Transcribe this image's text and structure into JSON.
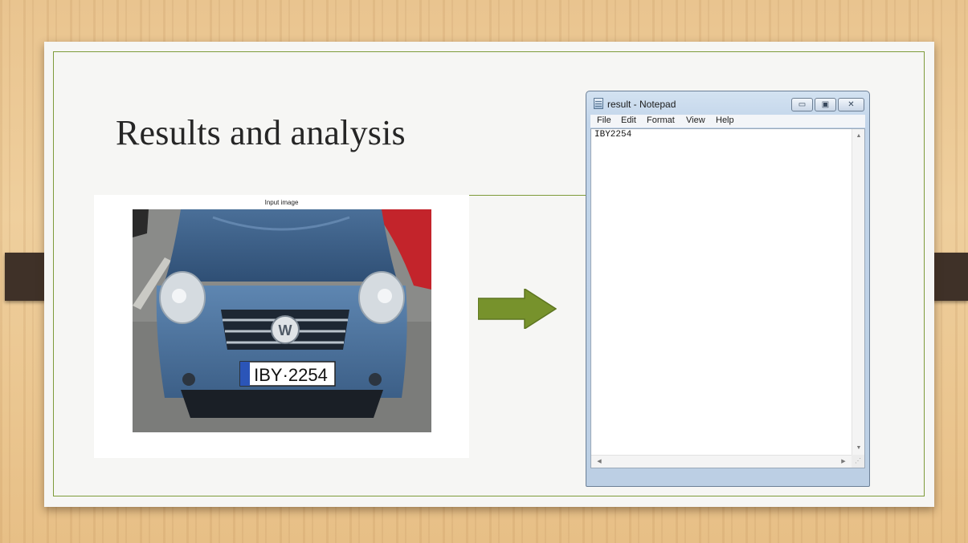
{
  "slide": {
    "title": "Results and analysis",
    "accent_color": "#7e9b3a",
    "tab_color": "#3f3128",
    "arrow_color": "#77922c"
  },
  "figure": {
    "caption": "Input image",
    "plate_text": "IBY·2254",
    "car_color": "#5b82aa"
  },
  "notepad": {
    "title": "result - Notepad",
    "icon": "notepad-icon",
    "window_buttons": {
      "minimize": "▭",
      "maximize": "▣",
      "close": "✕"
    },
    "menu": [
      "File",
      "Edit",
      "Format",
      "View",
      "Help"
    ],
    "content": "IBY2254",
    "scroll_icons": {
      "up": "▲",
      "down": "▼",
      "left": "◀",
      "right": "▶",
      "grip": "⋰"
    }
  }
}
